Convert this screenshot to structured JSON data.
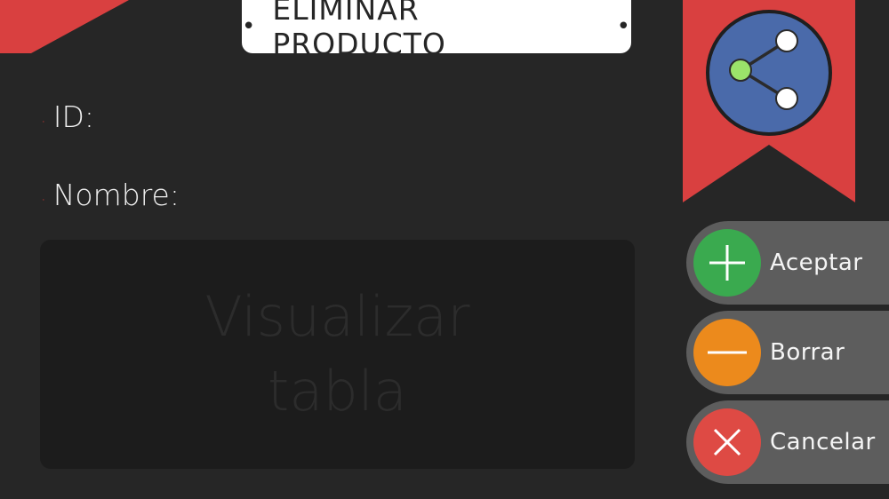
{
  "header": {
    "title": "ELIMINAR PRODUCTO",
    "dot_left": "•",
    "dot_right": "•"
  },
  "form": {
    "bullet": "·",
    "id_label": "ID:",
    "name_label": "Nombre:"
  },
  "table_panel": {
    "placeholder": "Visualizar\ntabla"
  },
  "share": {
    "icon": "share-icon"
  },
  "actions": [
    {
      "label": "Aceptar",
      "icon": "plus-icon",
      "color": "#3aaa4f"
    },
    {
      "label": "Borrar",
      "icon": "minus-icon",
      "color": "#ec8a1c"
    },
    {
      "label": "Cancelar",
      "icon": "close-icon",
      "color": "#de4a44"
    }
  ],
  "colors": {
    "background": "#262626",
    "accent_red": "#d94040",
    "share_blue": "#4a6aaa",
    "share_node_green": "#9be36a",
    "button_gray": "#5d5d5d"
  }
}
